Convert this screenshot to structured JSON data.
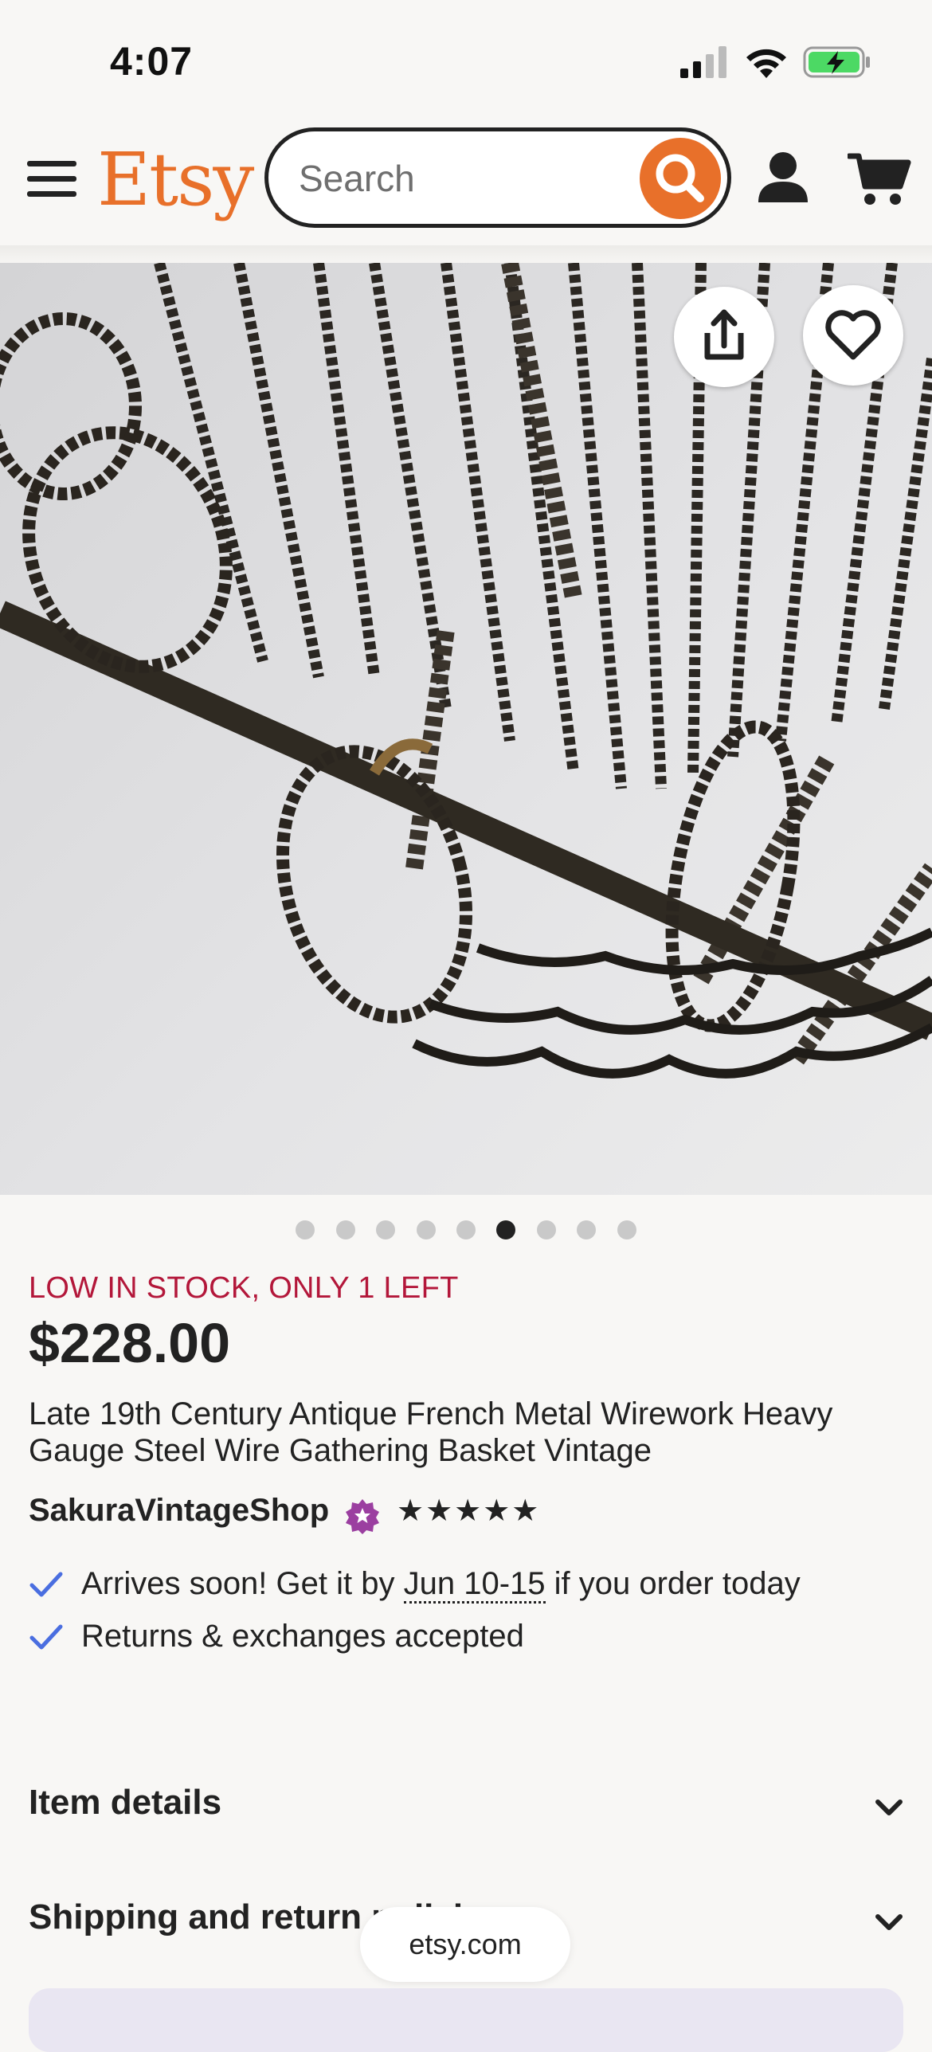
{
  "status_bar": {
    "time": "4:07"
  },
  "header": {
    "logo": "Etsy",
    "search_placeholder": "Search"
  },
  "gallery": {
    "image_count": 9,
    "active_index": 5
  },
  "listing": {
    "stock_notice": "LOW IN STOCK, ONLY 1 LEFT",
    "price": "$228.00",
    "title": "Late 19th Century Antique French Metal Wirework Heavy Gauge Steel Wire Gathering Basket Vintage",
    "shop_name": "SakuraVintageShop",
    "rating_stars": "★★★★★",
    "rating_value": 5
  },
  "highlights": {
    "arrival_prefix": "Arrives soon! Get it by ",
    "arrival_dates": "Jun 10-15",
    "arrival_suffix": " if you order today",
    "returns": "Returns & exchanges accepted"
  },
  "sections": {
    "item_details": "Item details",
    "shipping": "Shipping and return policies"
  },
  "browser": {
    "domain": "etsy.com"
  },
  "colors": {
    "brand_orange": "#e8702a",
    "stock_red": "#b3173a",
    "check_blue": "#4a6ee0",
    "star_seller_purple": "#9b3fa0"
  }
}
